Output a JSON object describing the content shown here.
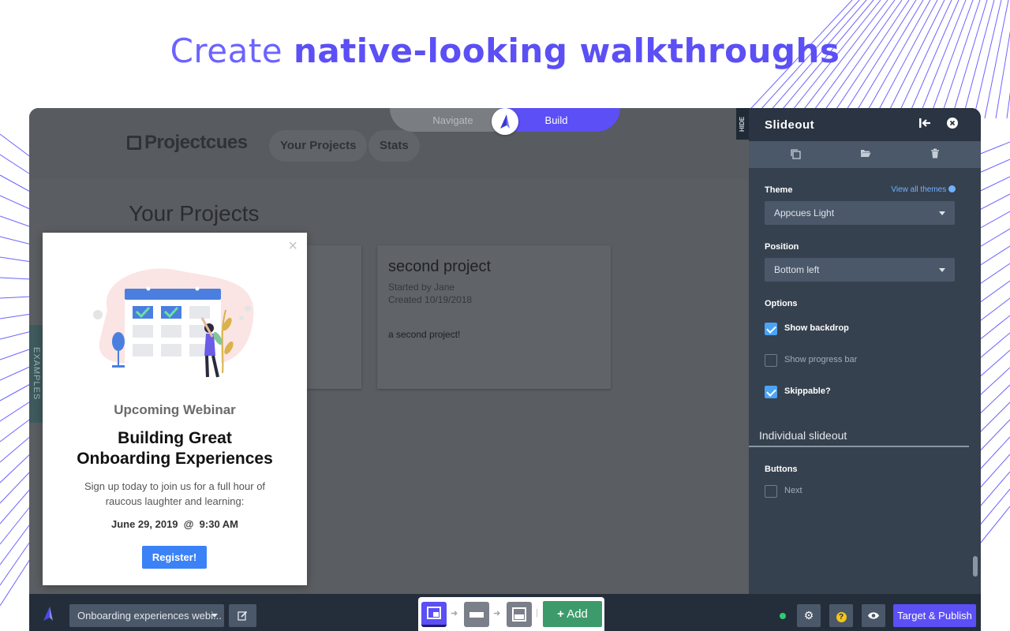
{
  "headline": {
    "prefix": "Create ",
    "emphasis": "native-looking walkthroughs"
  },
  "mode_toggle": {
    "left": "Navigate",
    "right": "Build"
  },
  "site": {
    "logo": "Projectcues",
    "nav": [
      "Your Projects",
      "Stats"
    ],
    "page_title": "Your Projects",
    "examples_tab": "EXAMPLES",
    "card": {
      "title": "second project",
      "started_by": "Started by Jane",
      "created": "Created 10/19/2018",
      "description": "a second project!"
    }
  },
  "modal": {
    "close": "×",
    "eyebrow": "Upcoming Webinar",
    "title_line1": "Building Great",
    "title_line2": "Onboarding Experiences",
    "body": "Sign up today to join us for a full hour of raucous laughter and learning:",
    "date": "June 29, 2019  @  9:30 AM",
    "button": "Register!"
  },
  "hide_tab": "HIDE",
  "panel": {
    "title": "Slideout",
    "theme_label": "Theme",
    "theme_link": "View all themes",
    "theme_value": "Appcues Light",
    "position_label": "Position",
    "position_value": "Bottom left",
    "options_label": "Options",
    "options": [
      {
        "label": "Show backdrop",
        "checked": true
      },
      {
        "label": "Show progress bar",
        "checked": false
      },
      {
        "label": "Skippable?",
        "checked": true
      }
    ],
    "section_title": "Individual slideout",
    "buttons_label": "Buttons",
    "buttons_options": [
      {
        "label": "Next",
        "checked": false
      }
    ]
  },
  "bottombar": {
    "flow_select": "Onboarding experiences webi...",
    "add_button": "Add",
    "publish_button": "Target & Publish",
    "help_icon": "?"
  },
  "colors": {
    "accent": "#5b4ff5",
    "panel": "#36414f",
    "check": "#4aa3f5",
    "add": "#3d9b6b",
    "register": "#3b82f6"
  }
}
